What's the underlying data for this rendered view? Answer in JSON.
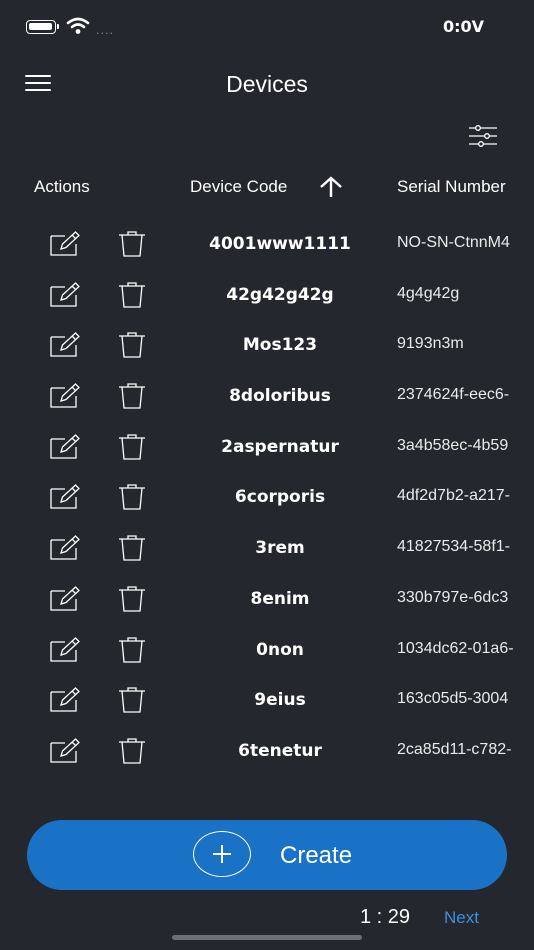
{
  "status": {
    "time": "0:0V",
    "signal": "...."
  },
  "header": {
    "title": "Devices"
  },
  "table": {
    "columns": {
      "actions": "Actions",
      "code": "Device Code",
      "serial": "Serial Number"
    },
    "rows": [
      {
        "code": "4001www1111",
        "serial": "NO-SN-CtnnM4"
      },
      {
        "code": "42g42g42g",
        "serial": "4g4g42g"
      },
      {
        "code": "Mos123",
        "serial": "9193n3m"
      },
      {
        "code": "8doloribus",
        "serial": "2374624f-eec6-"
      },
      {
        "code": "2aspernatur",
        "serial": "3a4b58ec-4b59"
      },
      {
        "code": "6corporis",
        "serial": "4df2d7b2-a217-"
      },
      {
        "code": "3rem",
        "serial": "41827534-58f1-"
      },
      {
        "code": "8enim",
        "serial": "330b797e-6dc3"
      },
      {
        "code": "0non",
        "serial": "1034dc62-01a6-"
      },
      {
        "code": "9eius",
        "serial": "163c05d5-3004"
      },
      {
        "code": "6tenetur",
        "serial": "2ca85d11-c782-"
      }
    ]
  },
  "create": {
    "label": "Create"
  },
  "pager": {
    "text": "1 : 29",
    "next": "Next"
  },
  "colors": {
    "background": "#24272d",
    "primary": "#1a72c7",
    "link": "#3b8fe0"
  },
  "icons": {
    "menu": "menu-icon",
    "filter": "sliders-icon",
    "sort": "arrow-up-icon",
    "edit": "edit-icon",
    "delete": "trash-icon",
    "add": "plus-icon"
  }
}
